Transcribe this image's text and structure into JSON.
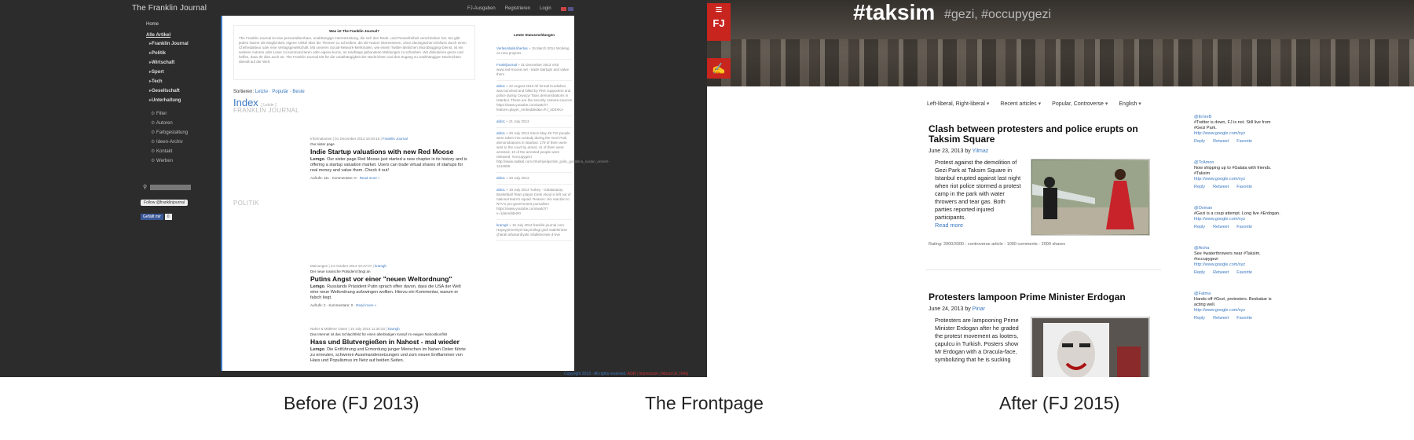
{
  "captions": {
    "before": "Before (FJ 2013)",
    "middle": "The Frontpage",
    "after": "After (FJ 2015)"
  },
  "old": {
    "brand": "The Franklin Journal",
    "topnav": [
      "FJ-Ausgaben",
      "Registrieren",
      "Login"
    ],
    "sidebar": {
      "home": "Home",
      "all": "Alle Artikel",
      "items": [
        "Franklin Journal",
        "Politik",
        "Wirtschaft",
        "Sport",
        "Tech",
        "Gesellschaft",
        "Unterhaltung"
      ],
      "tools": [
        "Filter",
        "Autoren",
        "Farbgestaltung",
        "Ideen-Archiv",
        "Kontakt",
        "Werben"
      ]
    },
    "search_placeholder": "suche #hashtag",
    "follow": "Follow @franklinjournal",
    "like": "Gefällt mir",
    "like_count": "0",
    "intro_title": "Was ist The Franklin Journal?",
    "intro_text": "The Franklin Journal ist eine personalisierbare, unabhängige Internetzeitung, die sich den Rede- und Pressefreiheit verschrieben hat. Sie gibt jedem Nutzer die Möglichkeit, eigene Artikel über die Themen zu schreiben, die die Nutzer interessieren, ohne ideologischen Einfluss durch einen Chefredakteur oder eine Verlagsgesellschaft. Mit unseren Social-Network-Merkmalen, wie einem Twitter-ähnlichen Microblogging-Dienst, ist ein anderer Autoren oder Leser zu kommunizieren oder eigene kurze, an Hashtags gebundene Meldungen zu schreiben. Wir diskutieren gerne und helfen, dass Ihr dies auch tut. The Franklin Journal tritt für die Unabhängigkeit der Nachrichten und den Zugang zu unabhängigen Nachrichten überall auf der Welt.",
    "sort_label": "Sortieren:",
    "sort_options": "Letzte · Populär · Beste",
    "index": "Index",
    "index_small": "[ Letzte ]",
    "sections": [
      "FRANKLIN JOURNAL",
      "POLITIK"
    ],
    "articles": [
      {
        "meta": "Informationen | 01 December 2013 16:40:15 | ",
        "meta_link": "Franklin Journal",
        "kicker": "Our sister page",
        "title": "Indie Startup valuations with new Red Moose",
        "lead": "Lemgo",
        "text": ". Our sister page Red Moose just started a new chapter in its history and is offering a startup valuation market. Users can trade virtual shares of startups for real money and value them. Check it out!",
        "foot": "Aufrufe: 111 · Kommentare: 0 · ",
        "more": "Read more »"
      },
      {
        "meta": "Meinungen | 24 October 2014 10:47:07 | ",
        "meta_link": "kramgh",
        "kicker": "Der neue russische Präsident fängt an",
        "title": "Putins Angst vor einer \"neuen Weltordnung\"",
        "lead": "Lemgo",
        "text": ". Russlands Präsident Putin sprach offen davon, dass die USA der Welt eine neue Weltordnung aufzwingen wollten. Hierzu ein Kommentar, warum er falsch liegt.",
        "foot": "Aufrufe: 2 · Kommentare: 0 · ",
        "more": "Read more »"
      },
      {
        "meta": "Naher & Mittlerer Osten | 15 July 2014 11:30:33 | ",
        "meta_link": "kramgh",
        "kicker": "Das Internet ist das Schlachtfeld für einen allerblutigen Kampf im ewigen Nahostkonflikt",
        "title": "Hass und Blutvergießen in Nahost - mal wieder",
        "lead": "Lemgo",
        "text": ". Die Entführung und Ermordung junger Menschen im Nahen Osten führte zu erneuten, schweren Auseinandersetzungen und zum neuen Entflammen von Hass und Populismus im Netz auf beiden Seiten.",
        "foot": "",
        "more": ""
      }
    ],
    "status_title": "Letzte Statusmeldungen",
    "status": [
      {
        "user": "Verlassitaliä.libertas",
        "text": " » 15 March 2014 Working on new projects"
      },
      {
        "user": "Frankljournal",
        "text": " » 31 December 2013 Visit www.red-moose.net - trade startups and value them"
      },
      {
        "user": "aldo1",
        "text": " » 22 August 2013 All formal Kurdishes was bunched and killed by PKK supporters and police during Ceyuçy! Taxis demonstrations in Istanbul. These are the security camera sources https://www.youtube.com/watch?feature=player_embedded&v=PJ_sD0XKA"
      },
      {
        "user": "aldo1",
        "text": " » 21 July 2013"
      },
      {
        "user": "aldo1",
        "text": " » 20 July 2013 Since May 28 710 people were taken into custody during the Gezi Park demonstrations in Istanbul. 179 of them were sent to the court by arrest, 41 of them were arrested, 10 of the arrested people were released. #occupygezi http://www.radikal.com.tr/turkiye/gezide_polis_gozaltina_suslan_arsrieh-1144559"
      },
      {
        "user": "aldo1",
        "text": " » 20 July 2013"
      },
      {
        "user": "aldo1",
        "text": " » 19 July 2013 Turkey - Galatasaray Basketball Team player Cenk Akyol is left out of national team's squad. Reason: His reaction to NTV's pro-government journalism https://www.youtube.com/watch?v=1dansdde2I0"
      },
      {
        "user": "kramgh",
        "text": " » 15 July 2013 franklin-journal.com Hayayyirmeniyet kaçırmilogi girdi vadeleriese çharali arbasardiyaki mâdiklecewe d-üve"
      }
    ],
    "copyright": "Copyright 2013 - All rights reserved.",
    "footer_links": "AGB | Impressum | About Us | FAQ"
  },
  "new": {
    "hashtag": "#taksim",
    "subtags": "#gezi, #occupygezi",
    "fj_label": "FJ",
    "menu_icon": "≡",
    "edit_icon": "✍",
    "filters": [
      "Left-liberal, Right-liberal",
      "Recent articles",
      "Popular, Controverse",
      "English"
    ],
    "articles": [
      {
        "title": "Clash between protesters and police erupts on Taksim Square",
        "date": "June 23, 2013 by ",
        "author": "Yilmaz",
        "text": "Protest against the demolition of Gezi Park at Taksim Square in Istanbul erupted against last night when riot police stormed a protest camp in the park with water throwers and tear gas. Both parties reported injured participants.",
        "more": "Read more",
        "rating": "Rating: 2900/3300 - controverse article - 1000 comments - 2000 shares"
      },
      {
        "title": "Protesters lampoon Prime Minister Erdogan",
        "date": "June 24, 2013 by ",
        "author": "Pinar",
        "text": "Protesters are lampooning Prime Minister Erdogan after he graded the protest movement as looters, çapulcu in Turkish. Posters show Mr Erdogan with a Dracula-face, symbolizing that he is sucking",
        "more": "",
        "rating": ""
      }
    ],
    "tweets": [
      {
        "user": "@EmreB",
        "text": "#Twitter is down, FJ is not. Still live from #Gezi Park.",
        "link": "http://www.google.com/xyz"
      },
      {
        "user": "@TcAmon",
        "text": "Now shipping up to #Galata with friends. #Taksim",
        "link": "http://www.google.com/xyz"
      },
      {
        "user": "@Osman",
        "text": "#Gezi is a coup attempt. Long live #Erdogan.",
        "link": "http://www.google.com/xyz"
      },
      {
        "user": "@Aicha",
        "text": "See #waterthrowers near #Taksim. #occupygezi",
        "link": "http://www.google.com/xyz"
      },
      {
        "user": "@Fatma",
        "text": "Hands off #Gezi, protesters. Besbakar is acting well.",
        "link": "http://www.google.com/xyz"
      }
    ],
    "tweet_actions": [
      "Reply",
      "Retweet",
      "Favorite"
    ]
  }
}
